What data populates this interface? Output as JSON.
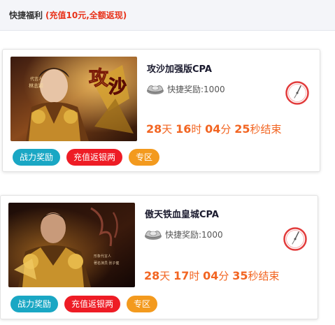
{
  "header": {
    "title": "快捷福利",
    "promo": "(充值10元,全额返现)"
  },
  "colors": {
    "accent_red": "#e8341c",
    "countdown_orange": "#f26522",
    "tag_teal": "#1aa7c4",
    "tag_red": "#ee1c25",
    "tag_orange": "#f39a1e"
  },
  "cards": [
    {
      "name": "攻沙加强版CPA",
      "banner_icon": "game-banner-image",
      "reward_icon": "silver-ingot-icon",
      "reward": "快捷奖励:1000",
      "clock_icon": "clock-icon",
      "countdown": {
        "days": "28",
        "days_unit": "天",
        "hours": "16",
        "hours_unit": "时",
        "minutes": "04",
        "minutes_unit": "分",
        "seconds": "25",
        "seconds_unit": "秒",
        "suffix": "结束"
      },
      "tags": [
        "战力奖励",
        "充值返银两",
        "专区"
      ]
    },
    {
      "name": "傲天铁血皇城CPA",
      "banner_icon": "game-banner-image",
      "reward_icon": "silver-ingot-icon",
      "reward": "快捷奖励:1000",
      "clock_icon": "clock-icon",
      "countdown": {
        "days": "28",
        "days_unit": "天",
        "hours": "17",
        "hours_unit": "时",
        "minutes": "04",
        "minutes_unit": "分",
        "seconds": "35",
        "seconds_unit": "秒",
        "suffix": "结束"
      },
      "tags": [
        "战力奖励",
        "充值返银两",
        "专区"
      ]
    }
  ]
}
